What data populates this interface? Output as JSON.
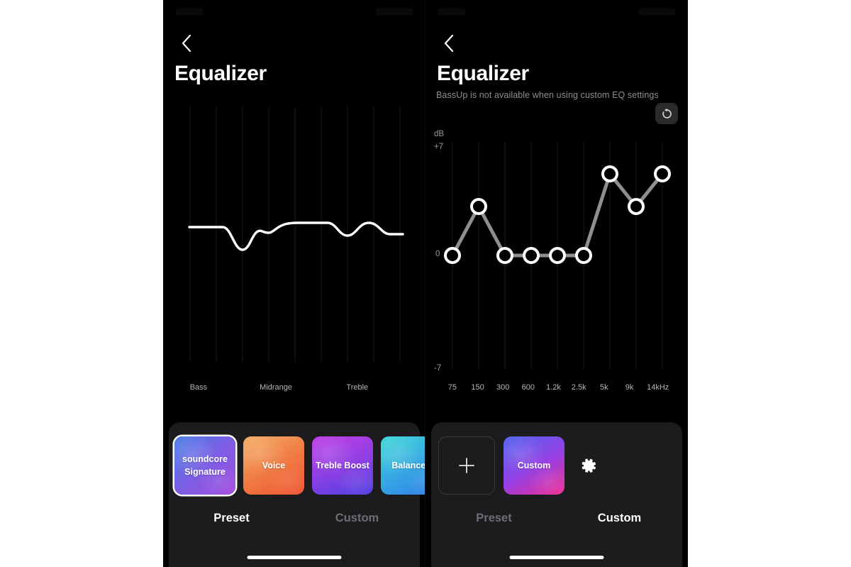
{
  "app": {
    "back_icon": "chevron-left-icon",
    "reset_icon": "reset-rotate-ccw-icon",
    "gear_icon": "gear-icon",
    "plus_icon": "plus-icon"
  },
  "left_panel": {
    "title": "Equalizer",
    "graph": {
      "x_labels": [
        "Bass",
        "Midrange",
        "Treble"
      ]
    },
    "presets": [
      {
        "label": "soundcore\nSignature",
        "label_line1": "soundcore",
        "label_line2": "Signature",
        "selected": true,
        "gradient_from": "#4a7fe8",
        "gradient_to": "#a34ae0"
      },
      {
        "label": "Voice",
        "label_line1": "Voice",
        "label_line2": "",
        "selected": false,
        "gradient_from": "#f0a65c",
        "gradient_to": "#ef5130"
      },
      {
        "label": "Treble Boost",
        "label_line1": "Treble Boost",
        "label_line2": "",
        "selected": false,
        "gradient_from": "#b93fe6",
        "gradient_to": "#4e3fe0"
      },
      {
        "label": "Balanced",
        "label_line1": "Balanced",
        "label_line2": "",
        "selected": false,
        "gradient_from": "#3fdbd8",
        "gradient_to": "#2f7ae8"
      }
    ],
    "tabs": [
      {
        "label": "Preset",
        "active": true
      },
      {
        "label": "Custom",
        "active": false
      }
    ]
  },
  "right_panel": {
    "title": "Equalizer",
    "subtitle": "BassUp is not available when using custom EQ settings",
    "axis": {
      "unit": "dB",
      "max_label": "+7",
      "zero_label": "0",
      "min_label": "-7"
    },
    "presets": [
      {
        "label": "Custom",
        "selected": false,
        "gradient_from": "#4f63ee",
        "gradient_to": "#f22b93"
      }
    ],
    "tabs": [
      {
        "label": "Preset",
        "active": false
      },
      {
        "label": "Custom",
        "active": true
      }
    ]
  },
  "chart_data": [
    {
      "type": "line",
      "title": "Equalizer",
      "xlabel": "",
      "ylabel": "",
      "categories": [
        "Bass",
        "Midrange",
        "Treble"
      ],
      "x": [
        0,
        0.08,
        0.16,
        0.23,
        0.3,
        0.38,
        0.46,
        0.55,
        0.64,
        0.72,
        0.8,
        0.88,
        1.0
      ],
      "values": [
        0,
        0,
        -0.18,
        -0.42,
        -0.42,
        -0.25,
        -0.1,
        0.04,
        0.04,
        -0.12,
        -0.02,
        0.06,
        -0.1
      ],
      "grid": true,
      "legend": "none",
      "note": "smooth soundcore Signature preset response curve, arbitrary units"
    },
    {
      "type": "line",
      "title": "Equalizer",
      "xlabel": "",
      "ylabel": "dB",
      "categories": [
        "75",
        "150",
        "300",
        "600",
        "1.2k",
        "2.5k",
        "5k",
        "9k",
        "14kHz"
      ],
      "values": [
        0,
        3.0,
        0,
        0,
        0,
        0,
        5.0,
        3.0,
        5.0
      ],
      "ylim": [
        -7,
        7
      ],
      "yticks": [
        7,
        0,
        -7
      ],
      "ytick_labels": [
        "+7",
        "0",
        "-7"
      ],
      "grid": true,
      "legend": "none",
      "markers": true,
      "note": "custom 9-band EQ; node markers are draggable"
    }
  ]
}
